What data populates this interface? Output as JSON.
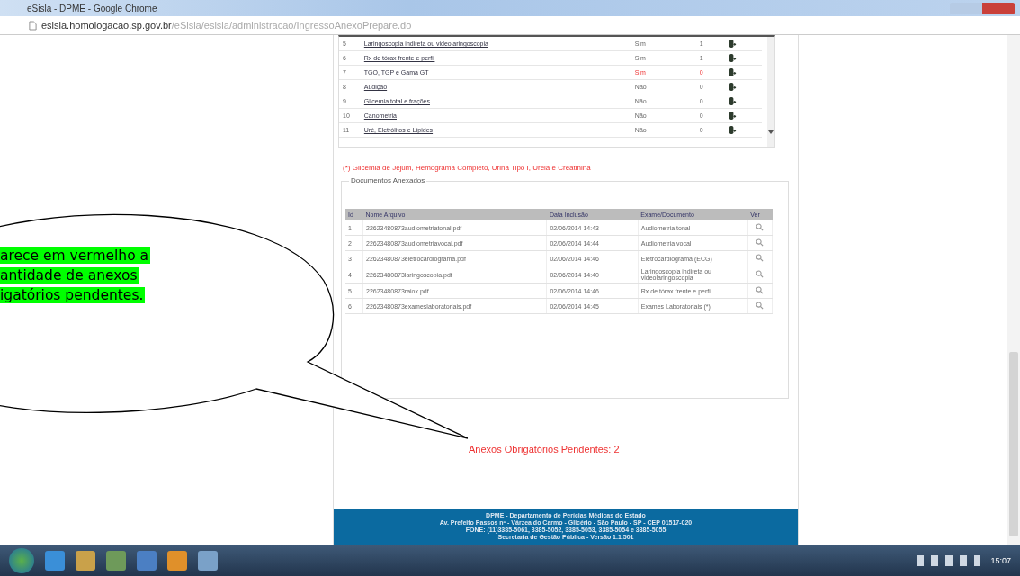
{
  "window": {
    "title": "eSisla - DPME - Google Chrome"
  },
  "address_bar": {
    "host": "esisla.homologacao.sp.gov.br",
    "path": "/eSisla/esisla/administracao/IngressoAnexoPrepare.do"
  },
  "exams": [
    {
      "number": "5",
      "name": "Laringoscopia indireta ou videolaringoscopia",
      "required": "Sim",
      "count": "1",
      "pending": false
    },
    {
      "number": "6",
      "name": "Rx de tórax frente e perfil",
      "required": "Sim",
      "count": "1",
      "pending": false
    },
    {
      "number": "7",
      "name": "TGO, TGP e Gama GT",
      "required": "Sim",
      "count": "0",
      "pending": true
    },
    {
      "number": "8",
      "name": "Audição",
      "required": "Não",
      "count": "0",
      "pending": false
    },
    {
      "number": "9",
      "name": "Glicemia total e frações",
      "required": "Não",
      "count": "0",
      "pending": false
    },
    {
      "number": "10",
      "name": "Canometria",
      "required": "Não",
      "count": "0",
      "pending": false
    },
    {
      "number": "11",
      "name": "Uré, Eletrólitos e Lípides",
      "required": "Não",
      "count": "0",
      "pending": false
    }
  ],
  "footnote": "(*) Glicemia de Jejum, Hemograma Completo, Urina Tipo I, Uréia e Creatinina",
  "attachments": {
    "legend": "Documentos Anexados",
    "columns": [
      "Id",
      "Nome Arquivo",
      "Data Inclusão",
      "Exame/Documento",
      "Ver"
    ],
    "rows": [
      {
        "id": "1",
        "file": "22623480873audiometriatonal.pdf",
        "date": "02/06/2014 14:43",
        "exam": "Audiometria tonal"
      },
      {
        "id": "2",
        "file": "22623480873audiometriavocal.pdf",
        "date": "02/06/2014 14:44",
        "exam": "Audiometria vocal"
      },
      {
        "id": "3",
        "file": "22623480873eletrocardiograma.pdf",
        "date": "02/06/2014 14:46",
        "exam": "Eletrocardiograma (ECG)"
      },
      {
        "id": "4",
        "file": "22623480873laringoscopia.pdf",
        "date": "02/06/2014 14:40",
        "exam": "Laringoscopia indireta ou videolaringoscopia"
      },
      {
        "id": "5",
        "file": "22623480873raiox.pdf",
        "date": "02/06/2014 14:46",
        "exam": "Rx de tórax frente e perfil"
      },
      {
        "id": "6",
        "file": "22623480873exameslaboratoriais.pdf",
        "date": "02/06/2014 14:45",
        "exam": "Exames Laboratoriais (*)"
      }
    ]
  },
  "pending_notice": "Anexos Obrigatórios Pendentes: 2",
  "footer": [
    "DPME - Departamento de Perícias Médicas do Estado",
    "Av. Prefeito Passos nº - Várzea do Carmo - Glicério - São Paulo - SP - CEP 01517-020",
    "FONE: (11)3385-5061, 3385-5052, 3385-5053, 3385-5054 e 3385-5055",
    "Secretaria de Gestão Pública - Versão 1.1.501"
  ],
  "callout": {
    "lines": [
      "arece em vermelho a",
      "antidade de anexos",
      "igatórios pendentes."
    ]
  },
  "taskbar": {
    "clock": "15:07"
  }
}
